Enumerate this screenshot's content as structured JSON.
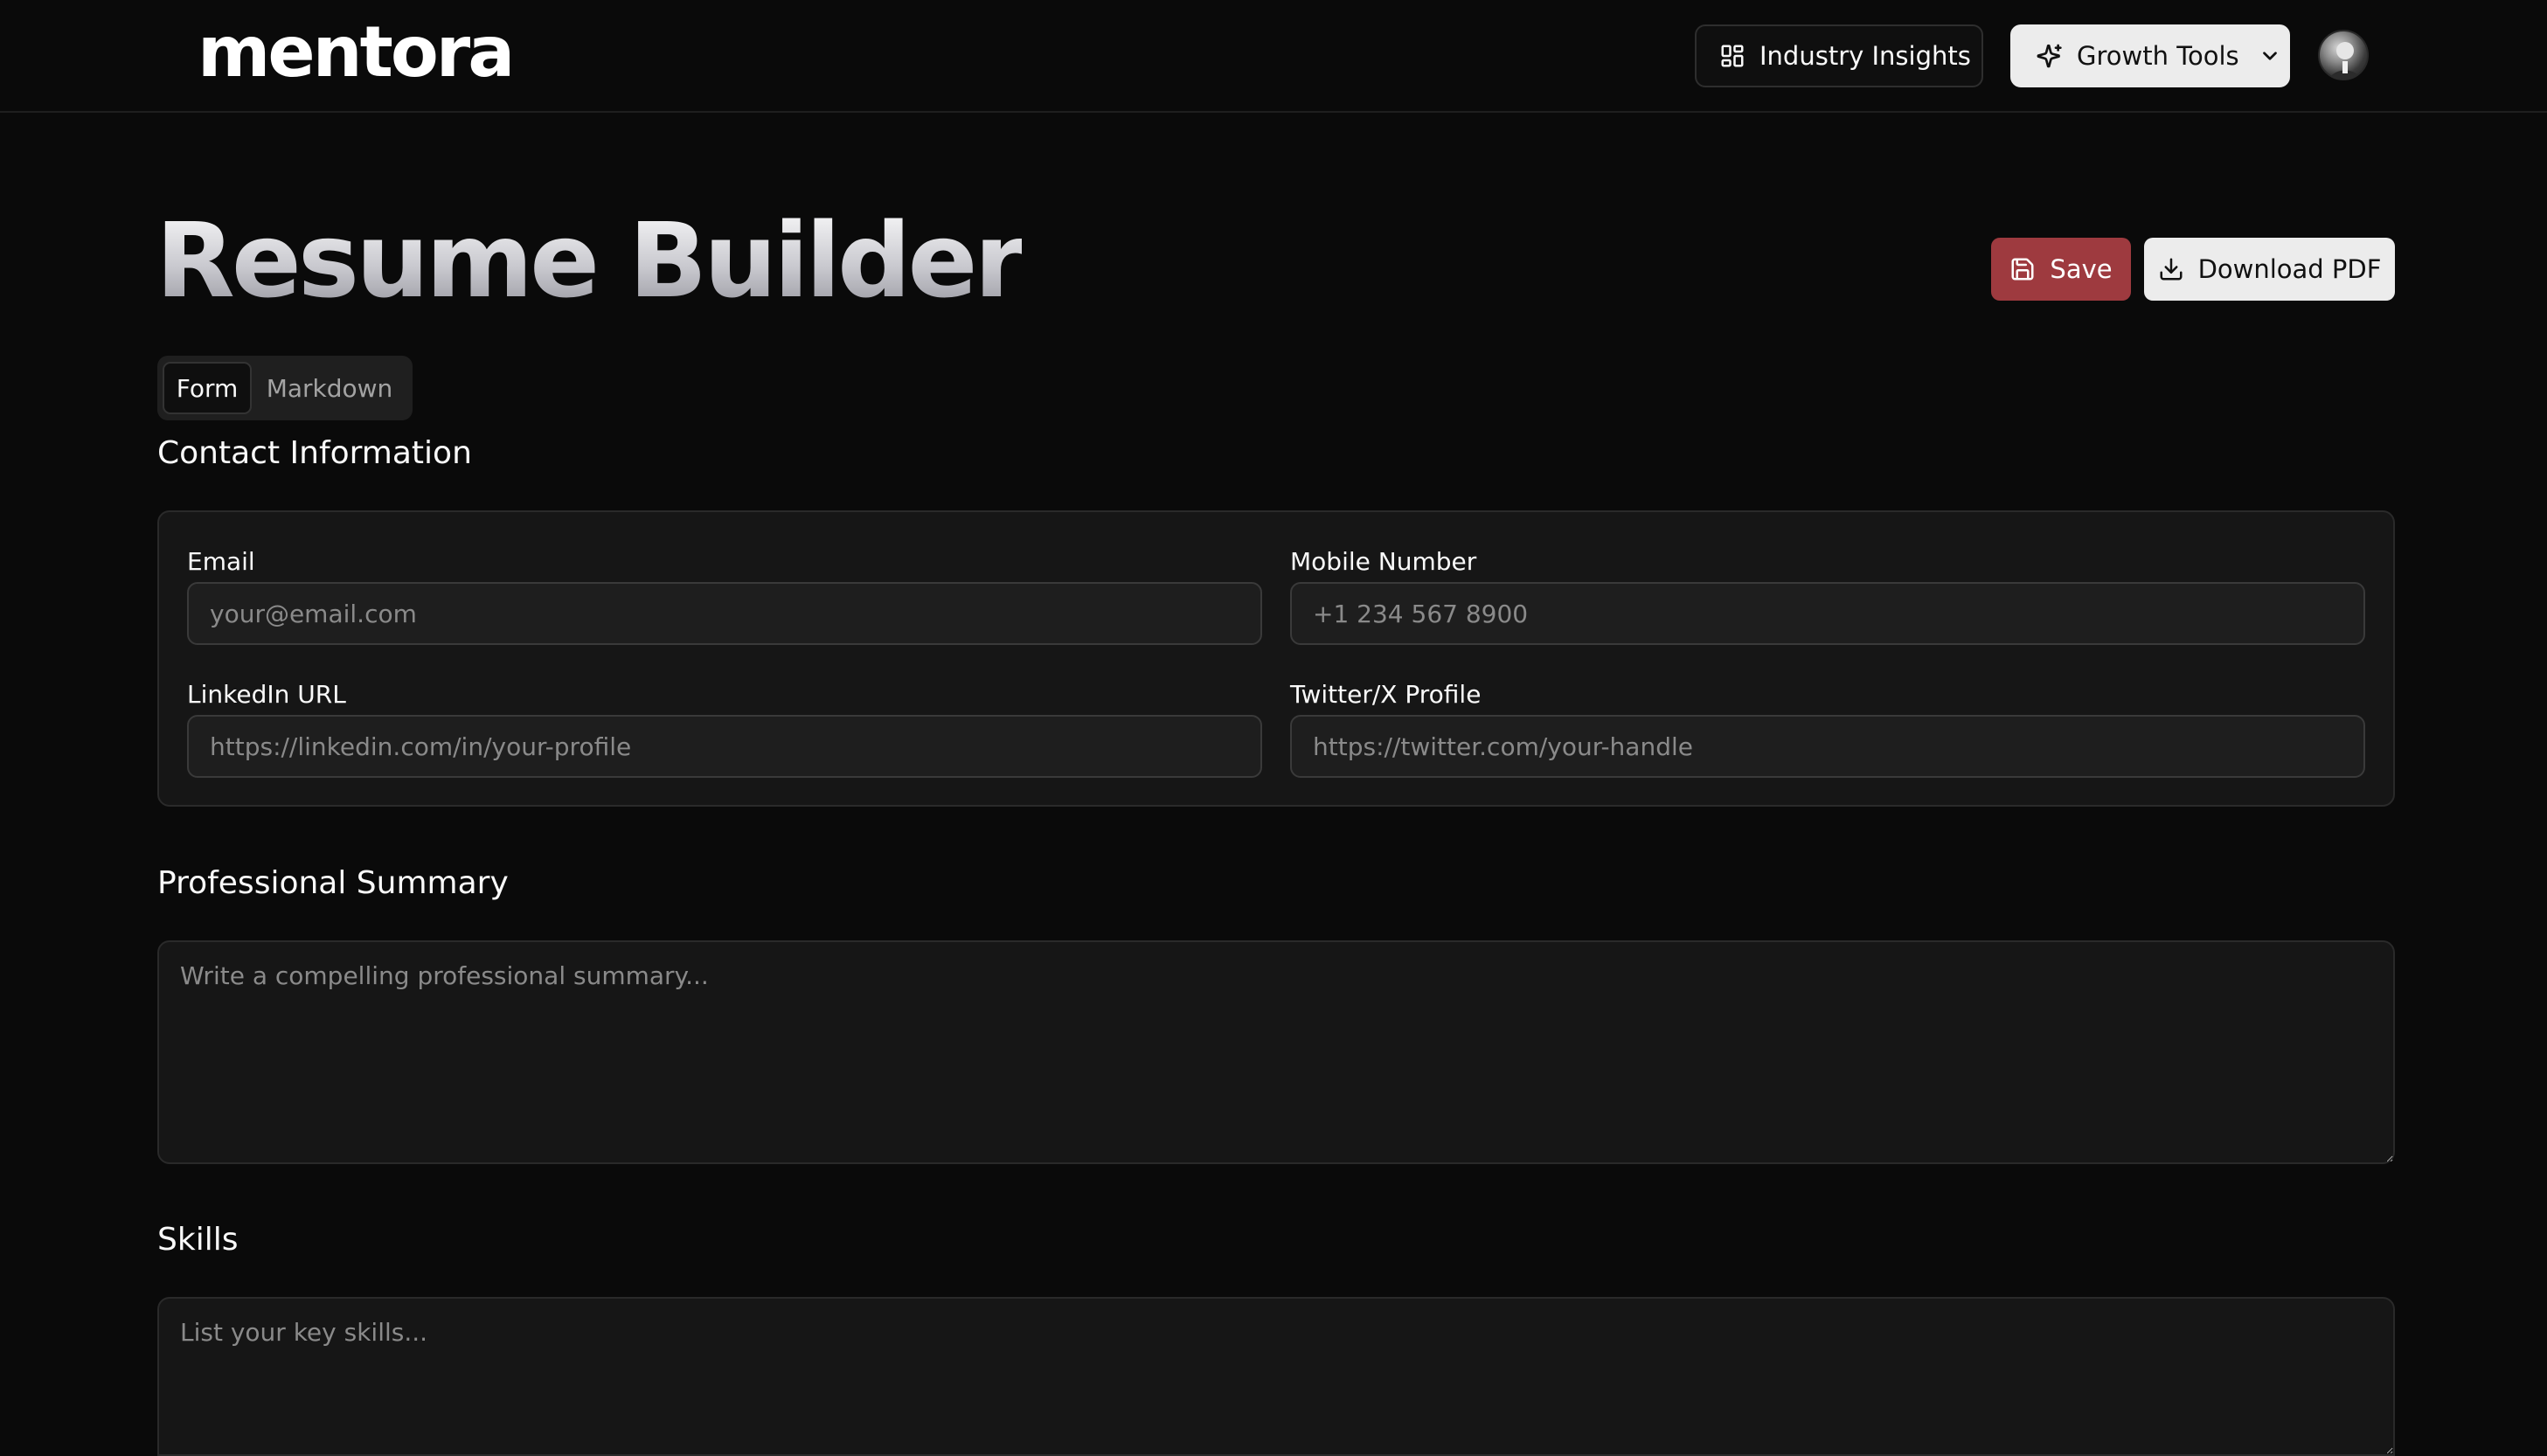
{
  "header": {
    "logo": "mentora",
    "nav": {
      "industry_insights": "Industry Insights",
      "growth_tools": "Growth Tools"
    },
    "avatar_icon": "user-avatar"
  },
  "page": {
    "title": "Resume Builder",
    "save_label": "Save",
    "download_label": "Download PDF"
  },
  "tabs": {
    "form": "Form",
    "markdown": "Markdown",
    "active": "Form"
  },
  "contact": {
    "title": "Contact Information",
    "email_label": "Email",
    "email_placeholder": "your@email.com",
    "mobile_label": "Mobile Number",
    "mobile_placeholder": "+1 234 567 8900",
    "linkedin_label": "LinkedIn URL",
    "linkedin_placeholder": "https://linkedin.com/in/your-profile",
    "twitter_label": "Twitter/X Profile",
    "twitter_placeholder": "https://twitter.com/your-handle"
  },
  "summary": {
    "title": "Professional Summary",
    "placeholder": "Write a compelling professional summary..."
  },
  "skills": {
    "title": "Skills",
    "placeholder": "List your key skills..."
  },
  "colors": {
    "background": "#0a0a0a",
    "save_accent": "#9e3a3f",
    "card": "#161616"
  }
}
